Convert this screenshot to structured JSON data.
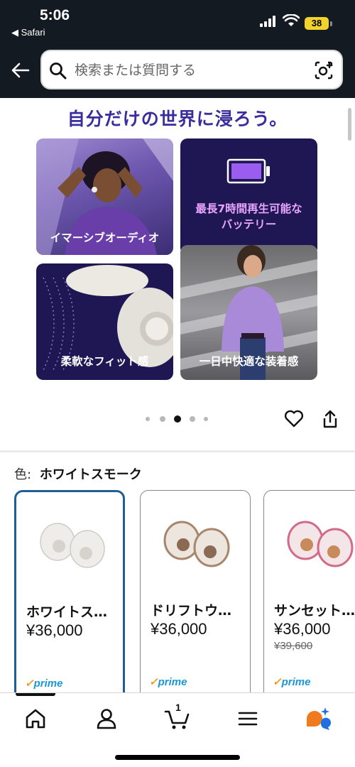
{
  "status_bar": {
    "time": "5:06",
    "back_app": "◀ Safari",
    "battery": "38"
  },
  "header": {
    "search_placeholder": "検索または質問する",
    "background_color": "#131a22"
  },
  "promo": {
    "title": "自分だけの世界に浸ろう。",
    "tiles": [
      {
        "label": "イマーシブオーディオ"
      },
      {
        "label_line1": "最長7時間再生可能な",
        "label_line2": "バッテリー"
      },
      {
        "label": "柔軟なフィット感"
      },
      {
        "label": "一日中快適な装着感"
      }
    ],
    "carousel_active_index": 2,
    "carousel_count": 5
  },
  "color_selector": {
    "label": "色:",
    "selected_value": "ホワイトスモーク"
  },
  "swatches": [
    {
      "name": "ホワイトス…",
      "price": "¥36,000",
      "strike_price": "",
      "prime": "prime"
    },
    {
      "name": "ドリフトウ…",
      "price": "¥36,000",
      "strike_price": "",
      "prime": "prime"
    },
    {
      "name": "サンセット…",
      "price": "¥36,000",
      "strike_price": "¥39,600",
      "prime": "prime"
    }
  ],
  "bottom_nav": {
    "cart_count": "1",
    "items": [
      "home-icon",
      "account-icon",
      "cart-icon",
      "menu-icon",
      "rufus-icon"
    ]
  },
  "colors": {
    "accent_purple": "#3a2d9c",
    "selected_border": "#1f5e97",
    "prime_blue": "#1a98d5"
  }
}
